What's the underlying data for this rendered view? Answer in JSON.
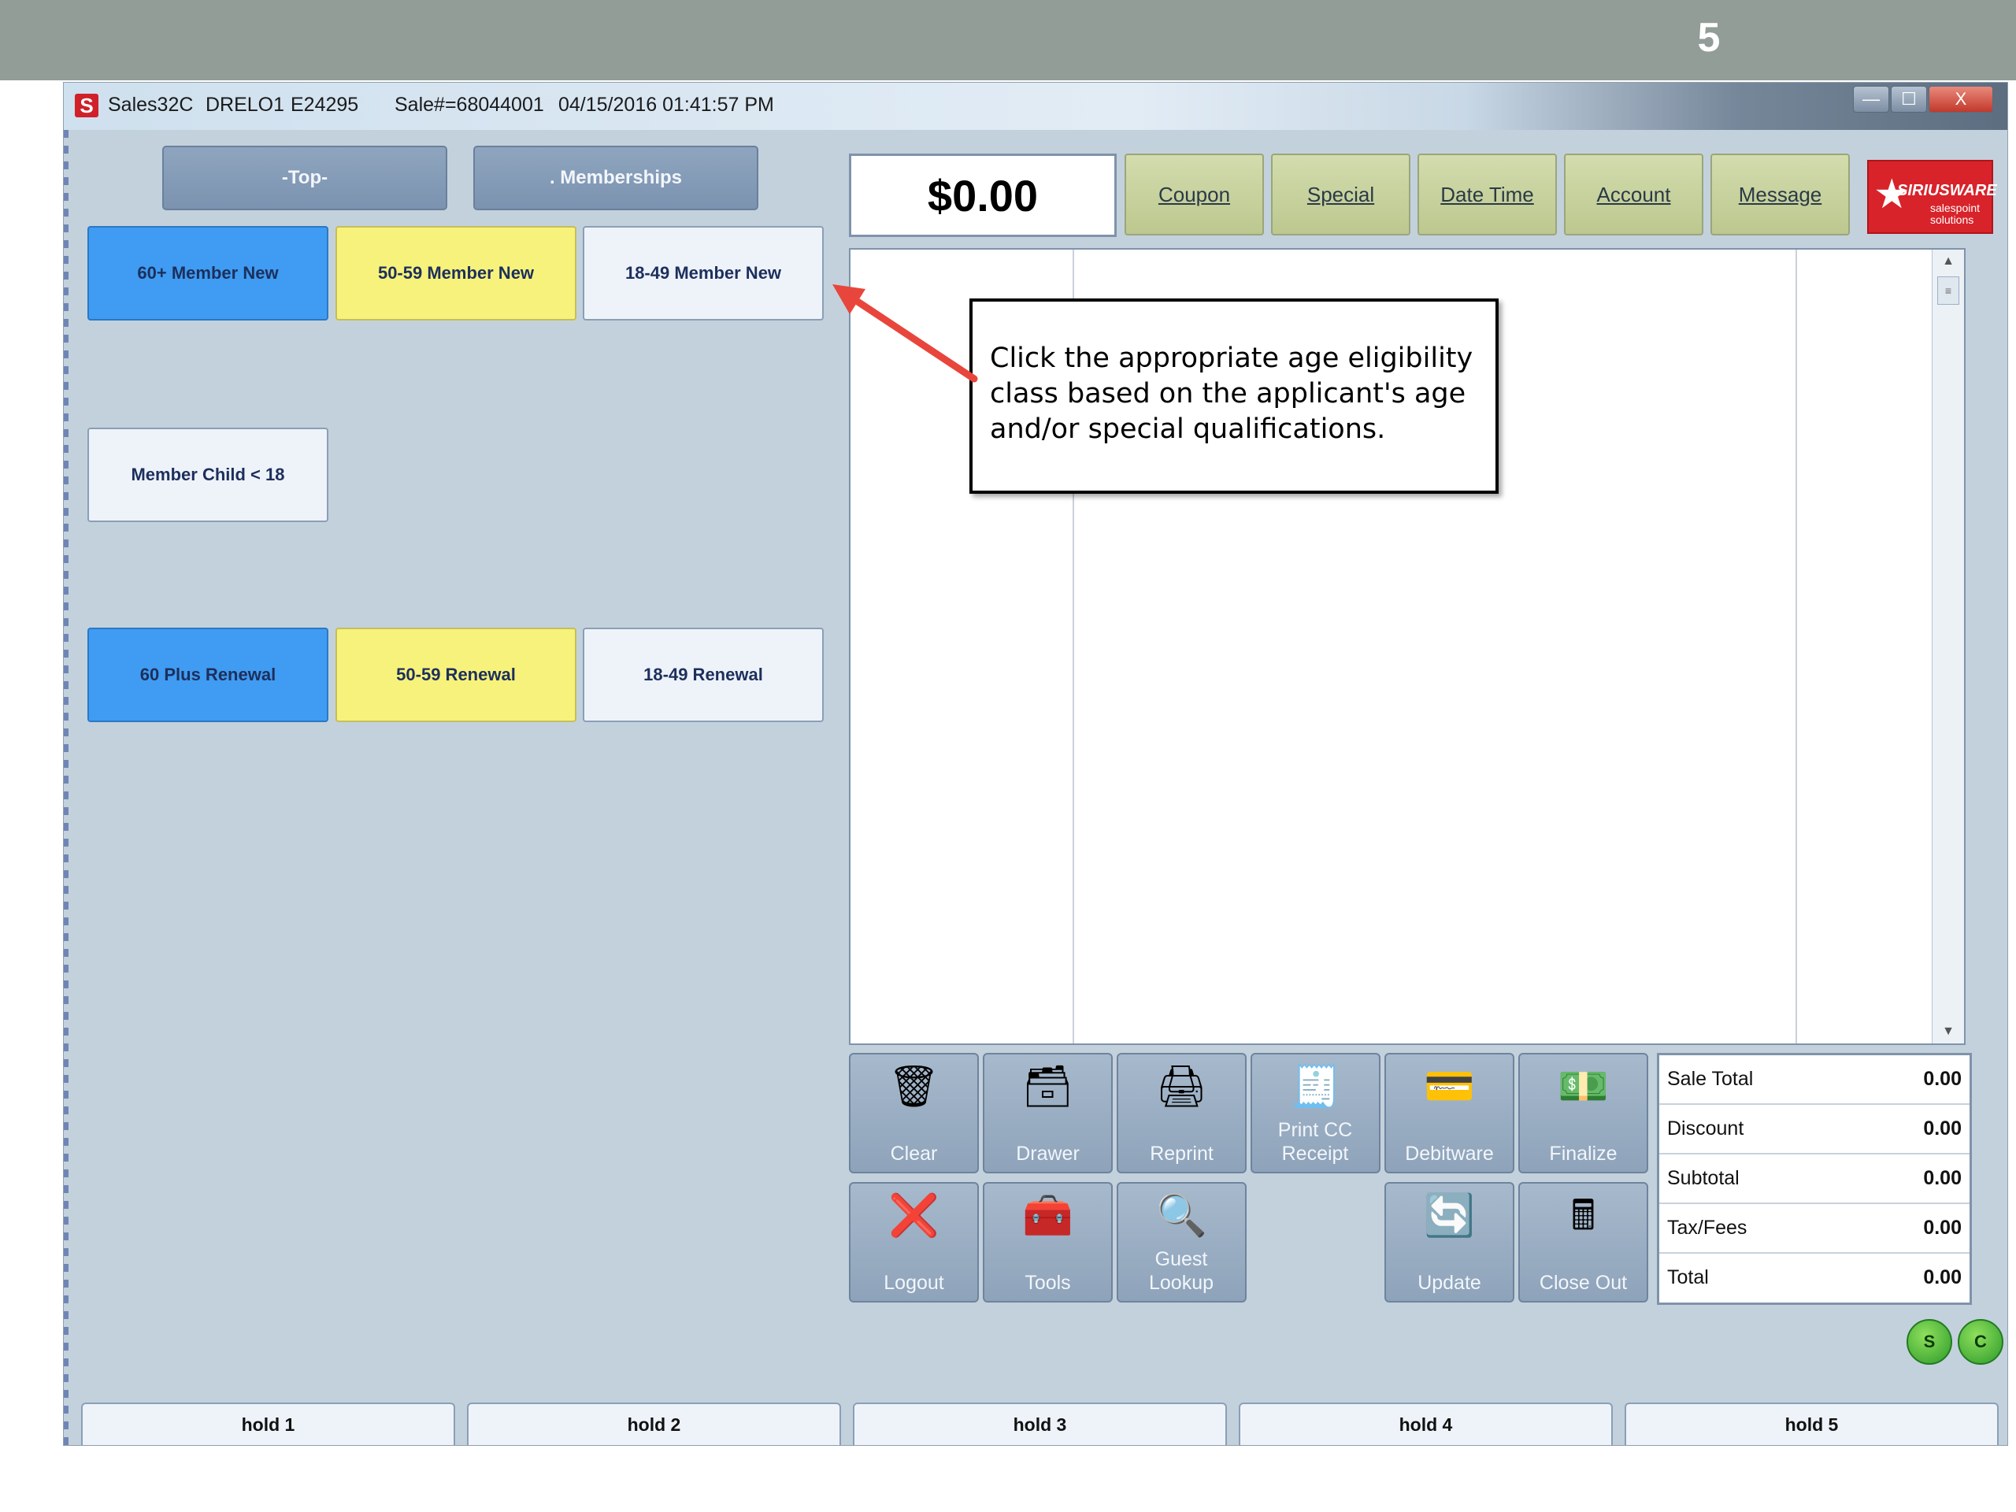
{
  "slide": {
    "number": "5"
  },
  "titlebar": {
    "app": "Sales32C",
    "user": "DRELO1",
    "terminal": "E24295",
    "sale_number": "Sale#=68044001",
    "datetime": "04/15/2016 01:41:57 PM"
  },
  "window_controls": {
    "minimize": "—",
    "maximize": "☐",
    "close": "X"
  },
  "nav": {
    "top": "-Top-",
    "memberships": ". Memberships"
  },
  "items": [
    {
      "label": "60+ Member New",
      "color": "#3f9cf2"
    },
    {
      "label": "50-59 Member New",
      "color": "#f7f27b"
    },
    {
      "label": "18-49 Member New",
      "color": "#eef3fa"
    },
    {
      "label": "Member Child < 18",
      "color": "#eef3fa"
    },
    {
      "label": "60 Plus Renewal",
      "color": "#3f9cf2"
    },
    {
      "label": "50-59 Renewal",
      "color": "#f7f27b"
    },
    {
      "label": "18-49 Renewal",
      "color": "#eef3fa"
    }
  ],
  "amount": "$0.00",
  "function_buttons": [
    "Coupon",
    "Special",
    "Date Time",
    "Account",
    "Message"
  ],
  "logo": {
    "main": "SIRIUSWARE",
    "sub": "salespoint solutions"
  },
  "callout": "Click the appropriate age eligibility class based on the applicant's age and/or special qualifications.",
  "actions": [
    {
      "label": "Clear",
      "icon": "trash-icon",
      "glyph": "🗑"
    },
    {
      "label": "Drawer",
      "icon": "drawer-icon",
      "glyph": "🗃"
    },
    {
      "label": "Reprint",
      "icon": "printer-icon",
      "glyph": "🖨"
    },
    {
      "label": "Print CC Receipt",
      "icon": "receipt-printer-icon",
      "glyph": "🧾"
    },
    {
      "label": "Debitware",
      "icon": "card-icon",
      "glyph": "💳"
    },
    {
      "label": "Finalize",
      "icon": "money-icon",
      "glyph": "💵"
    },
    {
      "label": "Logout",
      "icon": "close-icon",
      "glyph": "❌"
    },
    {
      "label": "Tools",
      "icon": "toolbox-icon",
      "glyph": "🧰"
    },
    {
      "label": "Guest Lookup",
      "icon": "magnifier-icon",
      "glyph": "🔍"
    },
    {
      "label": "Update",
      "icon": "refresh-icon",
      "glyph": "🔄"
    },
    {
      "label": "Close Out",
      "icon": "register-icon",
      "glyph": "🖩"
    }
  ],
  "totals": [
    {
      "label": "Sale Total",
      "value": "0.00"
    },
    {
      "label": "Discount",
      "value": "0.00"
    },
    {
      "label": "Subtotal",
      "value": "0.00"
    },
    {
      "label": "Tax/Fees",
      "value": "0.00"
    },
    {
      "label": "Total",
      "value": "0.00"
    }
  ],
  "status_buttons": [
    "S",
    "C"
  ],
  "holds": [
    "hold 1",
    "hold 2",
    "hold 3",
    "hold 4",
    "hold 5"
  ],
  "colors": {
    "arrow": "#e8463c",
    "function_button": "#c8d29e",
    "nav_button": "#8199b5",
    "action_button": "#9aadc2"
  }
}
